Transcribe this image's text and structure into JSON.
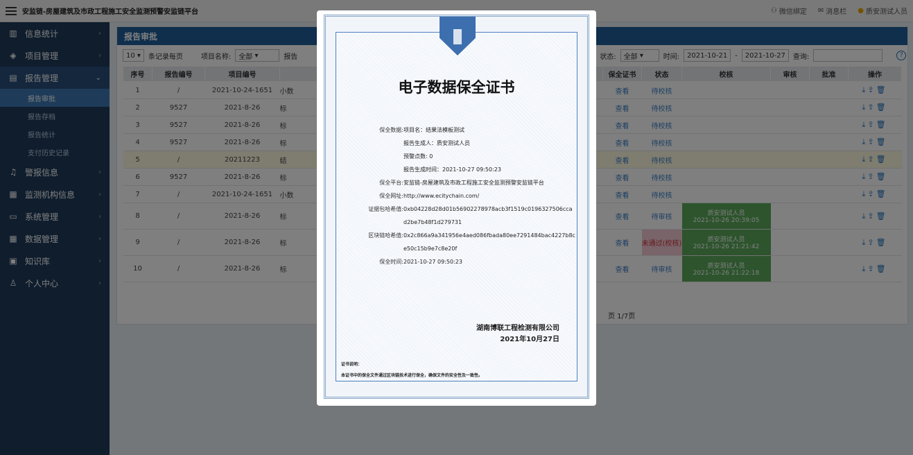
{
  "topbar": {
    "title": "安监链-房屋建筑及市政工程施工安全监测预警安监链平台",
    "wechat": "微信绑定",
    "messages": "消息栏",
    "user": "质安测试人员"
  },
  "sidebar": {
    "items": [
      "信息统计",
      "项目管理",
      "报告管理",
      "警报信息",
      "监测机构信息",
      "系统管理",
      "数据管理",
      "知识库",
      "个人中心"
    ],
    "sub": [
      "报告审批",
      "报告存档",
      "报告统计",
      "支付历史记录"
    ]
  },
  "panel": {
    "title": "报告审批",
    "per_page": "10",
    "per_page_label": "条记录每页",
    "project_label": "项目名称:",
    "project_value": "全部",
    "report_label": "报告",
    "status_label": "状态:",
    "status_value": "全部",
    "time_label": "时间:",
    "date_from": "2021-10-21",
    "date_sep": "-",
    "date_to": "2021-10-27",
    "query_label": "查询:"
  },
  "columns": [
    "序号",
    "报告编号",
    "项目编号",
    "保全证书",
    "状态",
    "校核",
    "审核",
    "批准",
    "操作"
  ],
  "rows": [
    {
      "no": "1",
      "code": "/",
      "proj": "2021-10-24-1651",
      "cut": "小数",
      "cert": "查看",
      "status": "待校核",
      "check": "",
      "checktime": ""
    },
    {
      "no": "2",
      "code": "9527",
      "proj": "2021-8-26",
      "cut": "标",
      "cert": "查看",
      "status": "待校核",
      "check": "",
      "checktime": ""
    },
    {
      "no": "3",
      "code": "9527",
      "proj": "2021-8-26",
      "cut": "标",
      "cert": "查看",
      "status": "待校核",
      "check": "",
      "checktime": ""
    },
    {
      "no": "4",
      "code": "9527",
      "proj": "2021-8-26",
      "cut": "标",
      "cert": "查看",
      "status": "待校核",
      "check": "",
      "checktime": ""
    },
    {
      "no": "5",
      "code": "/",
      "proj": "20211223",
      "cut": "结",
      "cert": "查看",
      "status": "待校核",
      "check": "",
      "checktime": ""
    },
    {
      "no": "6",
      "code": "9527",
      "proj": "2021-8-26",
      "cut": "标",
      "cert": "查看",
      "status": "待校核",
      "check": "",
      "checktime": ""
    },
    {
      "no": "7",
      "code": "/",
      "proj": "2021-10-24-1651",
      "cut": "小数",
      "cert": "查看",
      "status": "待校核",
      "check": "",
      "checktime": ""
    },
    {
      "no": "8",
      "code": "/",
      "proj": "2021-8-26",
      "cut": "标",
      "cert": "查看",
      "status": "待审核",
      "check": "质安测试人员",
      "checktime": "2021-10-26 20:39:05"
    },
    {
      "no": "9",
      "code": "/",
      "proj": "2021-8-26",
      "cut": "标",
      "cert": "查看",
      "status": "未通过(校核)",
      "check": "质安测试人员",
      "checktime": "2021-10-26 21:21:42"
    },
    {
      "no": "10",
      "code": "/",
      "proj": "2021-8-26",
      "cut": "标",
      "cert": "查看",
      "status": "待审核",
      "check": "质安测试人员",
      "checktime": "2021-10-26 21:22:18"
    }
  ],
  "pager": "页 1/7页",
  "certificate": {
    "title": "电子数据保全证书",
    "fields": [
      {
        "k": "保全数据:",
        "v": "项目名：结果法模板测试"
      },
      {
        "k": "",
        "v": "报告生成人：质安测试人员"
      },
      {
        "k": "",
        "v": "预警点数: 0"
      },
      {
        "k": "",
        "v": "报告生成时间：2021-10-27 09:50:23"
      },
      {
        "k": "保全平台:",
        "v": "安监链-房屋建筑及市政工程施工安全监测预警安监链平台"
      },
      {
        "k": "保全网址:",
        "v": "http://www.ecitychain.com/"
      },
      {
        "k": "证据包哈希值:",
        "v": "0xb04228d28d01b56902278978acb3f1519c0196327506ccad2be7b48f1d279731"
      },
      {
        "k": "区块链哈希值:",
        "v": "0x2c866a9a341956e4aed086fbada80ee7291484bac4227b8ce50c15b9e7c8e20f"
      },
      {
        "k": "保全时间:",
        "v": "2021-10-27 09:50:23"
      }
    ],
    "company": "湖南博联工程检测有限公司",
    "date": "2021年10月27日",
    "note_label": "证书说明：",
    "note": "本证书中的保全文件通过区块链技术进行保全，确保文件的安全性及一致性。"
  }
}
